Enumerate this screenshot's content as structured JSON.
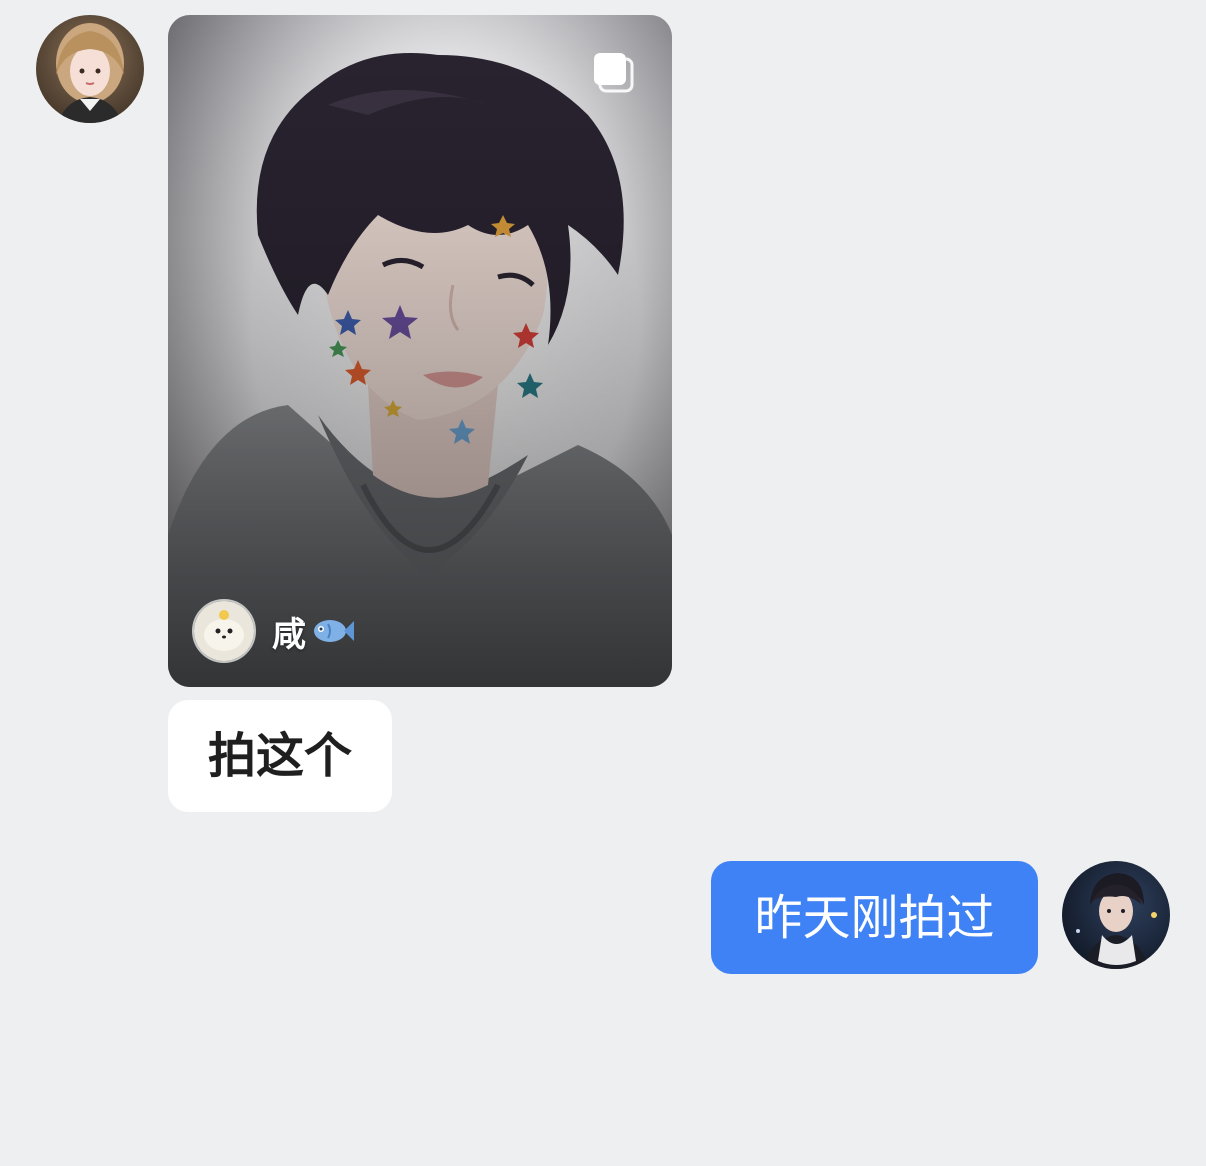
{
  "messages": {
    "incoming": {
      "shared_post": {
        "author_name": "咸",
        "author_badge_icon": "fish-icon",
        "multi_image_icon": "multi-image-icon"
      },
      "text": "拍这个"
    },
    "outgoing": {
      "text": "昨天刚拍过"
    }
  },
  "colors": {
    "background": "#eeeff1",
    "incoming_bubble": "#ffffff",
    "outgoing_bubble": "#3f82f5",
    "incoming_text": "#1f1f1f",
    "outgoing_text": "#ffffff"
  }
}
